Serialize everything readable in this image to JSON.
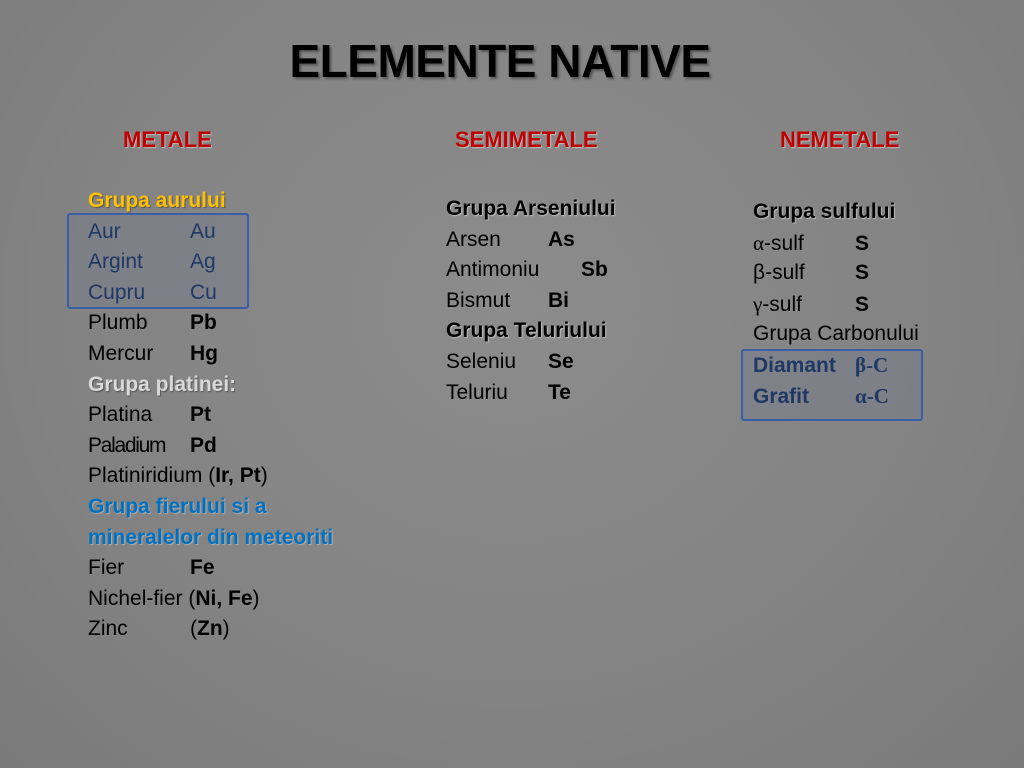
{
  "title": "ELEMENTE NATIVE",
  "columns": {
    "metale": {
      "heading": "METALE",
      "groups": {
        "aur": {
          "label": "Grupa aurului",
          "rows": [
            {
              "name": "Aur",
              "symbol": "Au"
            },
            {
              "name": "Argint",
              "symbol": "Ag"
            },
            {
              "name": "Cupru",
              "symbol": "Cu"
            },
            {
              "name": "Plumb",
              "symbol": "Pb"
            },
            {
              "name": "Mercur",
              "symbol": "Hg"
            }
          ]
        },
        "platina": {
          "label": "Grupa platinei:",
          "rows": [
            {
              "name": "Platina",
              "symbol": "Pt"
            },
            {
              "name": "Paladium",
              "symbol": "Pd"
            }
          ],
          "platiniridium": {
            "name": "Platiniridium (",
            "symbol": "Ir, Pt",
            "close": ")"
          }
        },
        "fier": {
          "label_line1": "Grupa fierului si a",
          "label_line2": "mineralelor din meteoriti",
          "fier_row": {
            "name": "Fier",
            "symbol": "Fe"
          },
          "nichel_row": {
            "name": "Nichel-fier (",
            "symbol": "Ni, Fe",
            "close": ")"
          },
          "zinc_row": {
            "name": "Zinc",
            "open": "(",
            "symbol": "Zn",
            "close": ")"
          }
        }
      }
    },
    "semimetale": {
      "heading": "SEMIMETALE",
      "groups": {
        "arseniu": {
          "label": "Grupa Arseniului",
          "rows": [
            {
              "name": "Arsen",
              "symbol": "As"
            },
            {
              "name": "Antimoniu",
              "symbol": "Sb"
            },
            {
              "name": "Bismut",
              "symbol": "Bi"
            }
          ]
        },
        "teluriu": {
          "label": "Grupa Teluriului",
          "rows": [
            {
              "name": "Seleniu",
              "symbol": "Se"
            },
            {
              "name": "Teluriu",
              "symbol": "Te"
            }
          ]
        }
      }
    },
    "nemetale": {
      "heading": "NEMETALE",
      "groups": {
        "sulf": {
          "label": "Grupa sulfului",
          "rows": [
            {
              "greek": "α",
              "name": "-sulf",
              "symbol": "S"
            },
            {
              "greek": "β",
              "name": "-sulf",
              "symbol": "S"
            },
            {
              "greek": "γ",
              "name": "-sulf",
              "symbol": "S"
            }
          ]
        },
        "carbon": {
          "label": "Grupa Carbonului",
          "rows": [
            {
              "name": "Diamant",
              "symbol": "β-C"
            },
            {
              "name": "Grafit",
              "symbol": "α-C"
            }
          ]
        }
      }
    }
  },
  "colors": {
    "background": "#838383",
    "heading_red": "#c00000",
    "gold_group": "#ffc000",
    "grey_group": "#d9d9d9",
    "blue_group": "#0070c0",
    "navy_text": "#1f3864",
    "box_border": "#3a5fa8"
  }
}
